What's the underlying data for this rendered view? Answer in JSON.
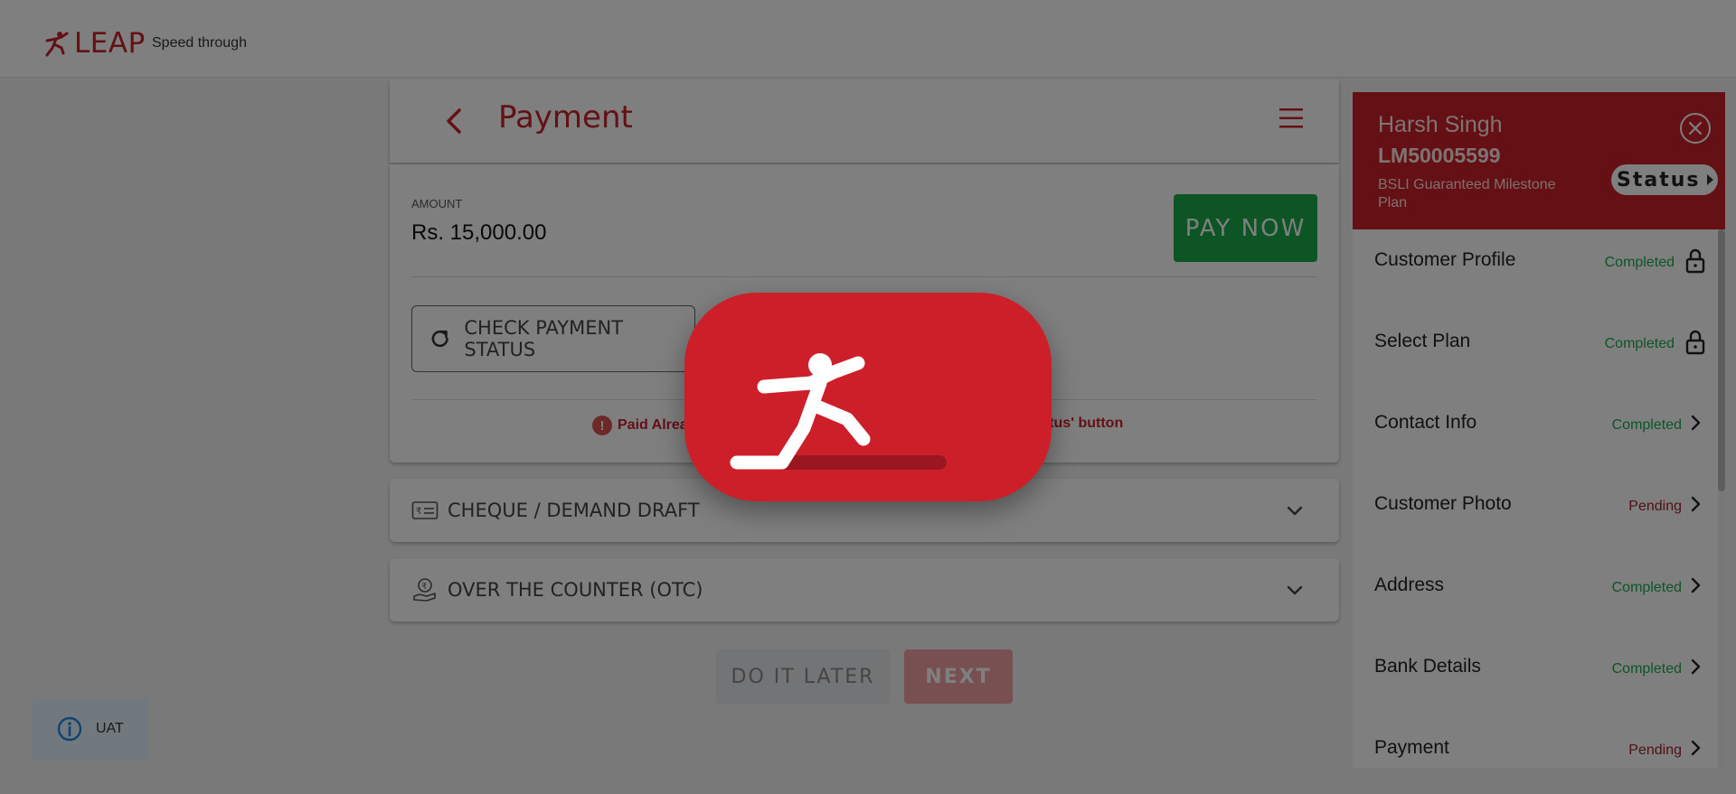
{
  "header": {
    "logo_text": "LEAP",
    "tagline": "Speed through"
  },
  "page": {
    "title": "Payment",
    "back_icon": "chevron-left-icon",
    "menu_icon": "hamburger-menu-icon"
  },
  "payment": {
    "amount_label": "AMOUNT",
    "amount_value": "Rs. 15,000.00",
    "pay_now_label": "PAY NOW",
    "check_status_label": "CHECK PAYMENT STATUS",
    "notice_left": "Paid Alrea",
    "notice_right": "tatus' button"
  },
  "accordions": [
    {
      "label": "CHEQUE / DEMAND DRAFT",
      "icon": "cheque-icon"
    },
    {
      "label": "OVER THE COUNTER (OTC)",
      "icon": "hand-coin-icon"
    }
  ],
  "actions": {
    "later_label": "DO IT LATER",
    "next_label": "NEXT"
  },
  "env_badge": {
    "label": "UAT",
    "icon": "info-icon"
  },
  "customer": {
    "name": "Harsh Singh",
    "id": "LM50005599",
    "plan": "BSLI Guaranteed Milestone Plan",
    "status_label": "Status"
  },
  "steps": [
    {
      "name": "Customer Profile",
      "state": "Completed",
      "icon": "lock-icon"
    },
    {
      "name": "Select Plan",
      "state": "Completed",
      "icon": "lock-icon"
    },
    {
      "name": "Contact Info",
      "state": "Completed",
      "icon": "chevron-right-icon"
    },
    {
      "name": "Customer Photo",
      "state": "Pending",
      "icon": "chevron-right-icon"
    },
    {
      "name": "Address",
      "state": "Completed",
      "icon": "chevron-right-icon"
    },
    {
      "name": "Bank Details",
      "state": "Completed",
      "icon": "chevron-right-icon"
    },
    {
      "name": "Payment",
      "state": "Pending",
      "icon": "chevron-right-icon"
    }
  ],
  "colors": {
    "brand_red": "#c8202a",
    "success_green": "#1aab4b",
    "pending_red": "#a0252c"
  }
}
